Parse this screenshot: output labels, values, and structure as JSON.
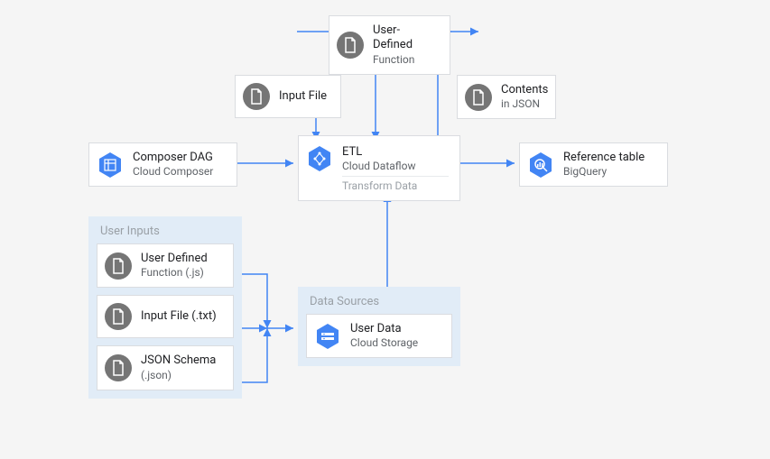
{
  "nodes": {
    "udf_top": {
      "title": "User-Defined",
      "subtitle": "Function"
    },
    "input_file": {
      "title": "Input File"
    },
    "contents_json": {
      "title": "Contents",
      "subtitle": "in JSON"
    },
    "composer": {
      "title": "Composer DAG",
      "subtitle": "Cloud Composer"
    },
    "etl": {
      "title": "ETL",
      "subtitle": "Cloud Dataflow",
      "subtitle2": "Transform Data"
    },
    "ref_table": {
      "title": "Reference table",
      "subtitle": "BigQuery"
    },
    "udf_js": {
      "title": "User Defined",
      "subtitle": "Function (.js)"
    },
    "input_txt": {
      "title": "Input File (.txt)"
    },
    "json_schema": {
      "title": "JSON Schema",
      "subtitle": "(.json)"
    },
    "user_data": {
      "title": "User Data",
      "subtitle": "Cloud Storage"
    }
  },
  "groups": {
    "user_inputs": {
      "title": "User Inputs"
    },
    "data_sources": {
      "title": "Data Sources"
    }
  },
  "colors": {
    "blue": "#4285f4",
    "grey": "#757575",
    "group_bg": "#e1ecf7"
  }
}
